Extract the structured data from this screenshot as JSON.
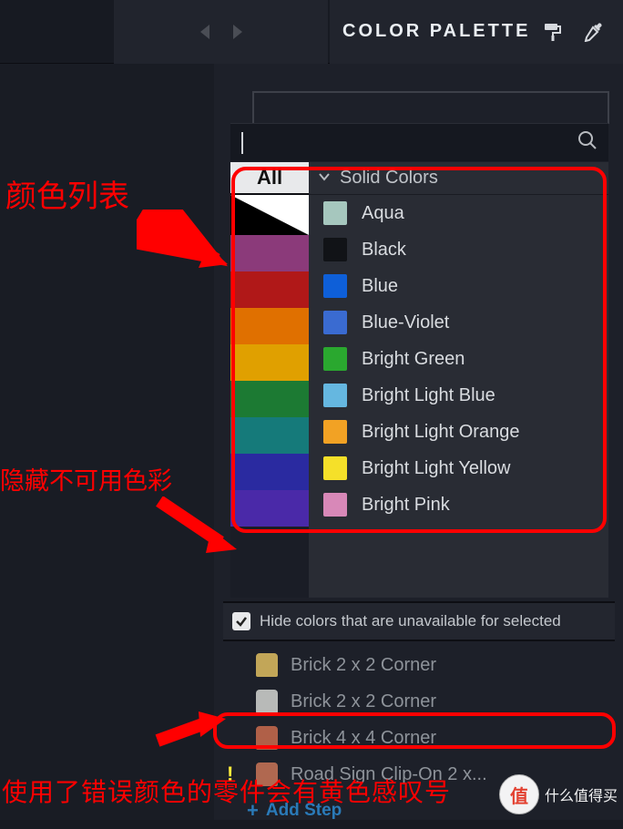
{
  "header": {
    "title": "COLOR PALETTE"
  },
  "search": {
    "value": ""
  },
  "palette": {
    "allTab": "All",
    "groupHeader": "Solid Colors",
    "leftSwatches": [
      {
        "type": "tri",
        "c1": "#000",
        "c2": "#fff"
      },
      {
        "type": "solid",
        "c": "#8b3a7a"
      },
      {
        "type": "solid",
        "c": "#b01818"
      },
      {
        "type": "solid",
        "c": "#e07000"
      },
      {
        "type": "solid",
        "c": "#e0a000"
      },
      {
        "type": "solid",
        "c": "#1c7a33"
      },
      {
        "type": "solid",
        "c": "#157a7a"
      },
      {
        "type": "solid",
        "c": "#2a2aa0"
      },
      {
        "type": "solid",
        "c": "#4a29a8"
      }
    ],
    "colors": [
      {
        "name": "Aqua",
        "hex": "#a6c7be"
      },
      {
        "name": "Black",
        "hex": "#111317"
      },
      {
        "name": "Blue",
        "hex": "#0e5fd8"
      },
      {
        "name": "Blue-Violet",
        "hex": "#3a6bd1"
      },
      {
        "name": "Bright Green",
        "hex": "#2aa82f"
      },
      {
        "name": "Bright Light Blue",
        "hex": "#65b7e0"
      },
      {
        "name": "Bright Light Orange",
        "hex": "#f2a224"
      },
      {
        "name": "Bright Light Yellow",
        "hex": "#f5e029"
      },
      {
        "name": "Bright Pink",
        "hex": "#d888b8"
      }
    ]
  },
  "hideColors": {
    "checked": true,
    "label": "Hide colors that are unavailable for selected"
  },
  "bricks": [
    {
      "name": "Brick 2 x 2 Corner",
      "color": "#c2a658",
      "warn": false
    },
    {
      "name": "Brick 2 x 2 Corner",
      "color": "#b8bab8",
      "warn": false
    },
    {
      "name": "Brick 4 x 4 Corner",
      "color": "#b06048",
      "warn": false
    },
    {
      "name": "Road Sign Clip-On 2 x...",
      "color": "#b06850",
      "warn": true
    }
  ],
  "addStep": "Add Step",
  "annotations": {
    "a1": "颜色列表",
    "a2": "隐藏不可用色彩",
    "a3": "使用了错误颜色的零件会有黄色感叹号"
  },
  "watermark": {
    "symbol": "值",
    "text": "什么值得买"
  }
}
